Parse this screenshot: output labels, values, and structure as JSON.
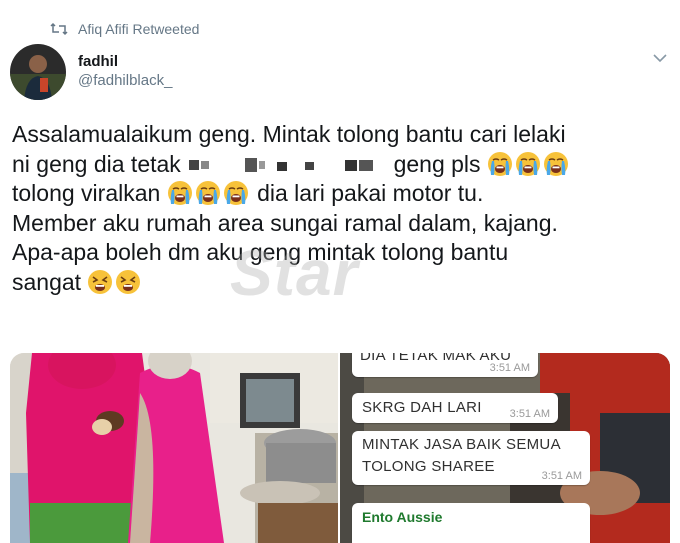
{
  "retweet": {
    "label": "Afiq Afifi Retweeted"
  },
  "user": {
    "name": "fadhil",
    "handle": "@fadhilblack_"
  },
  "tweet": {
    "lines": {
      "l1": "Assalamualaikum geng. Mintak tolong bantu cari lelaki",
      "l2_before": "ni geng dia tetak",
      "l2_after": "geng pls",
      "l3_before": "tolong viralkan",
      "l3_after": "dia lari pakai motor tu.",
      "l4": "Member aku rumah area sungai ramal dalam, kajang.",
      "l5": "Apa-apa boleh dm aku geng mintak tolong bantu",
      "l6": "sangat"
    }
  },
  "watermark": "Star",
  "chat": {
    "top_partial": "DIA TETAK MAK AKU",
    "top_time": "3:51 AM",
    "msg1": "SKRG DAH LARI",
    "msg1_time": "3:51 AM",
    "msg2_line1": "MINTAK JASA BAIK SEMUA",
    "msg2_line2": "TOLONG SHAREE",
    "msg2_time": "3:51 AM",
    "sender": "Ento Aussie"
  },
  "icons": {
    "retweet": "retweet-icon",
    "chevron": "chevron-down-icon",
    "emoji_cry": "loudly-crying-face-emoji",
    "emoji_tired": "tired-face-emoji"
  },
  "colors": {
    "secondary_text": "#657786",
    "primary_text": "#14171a",
    "wa_sender": "#1f7a2e"
  }
}
